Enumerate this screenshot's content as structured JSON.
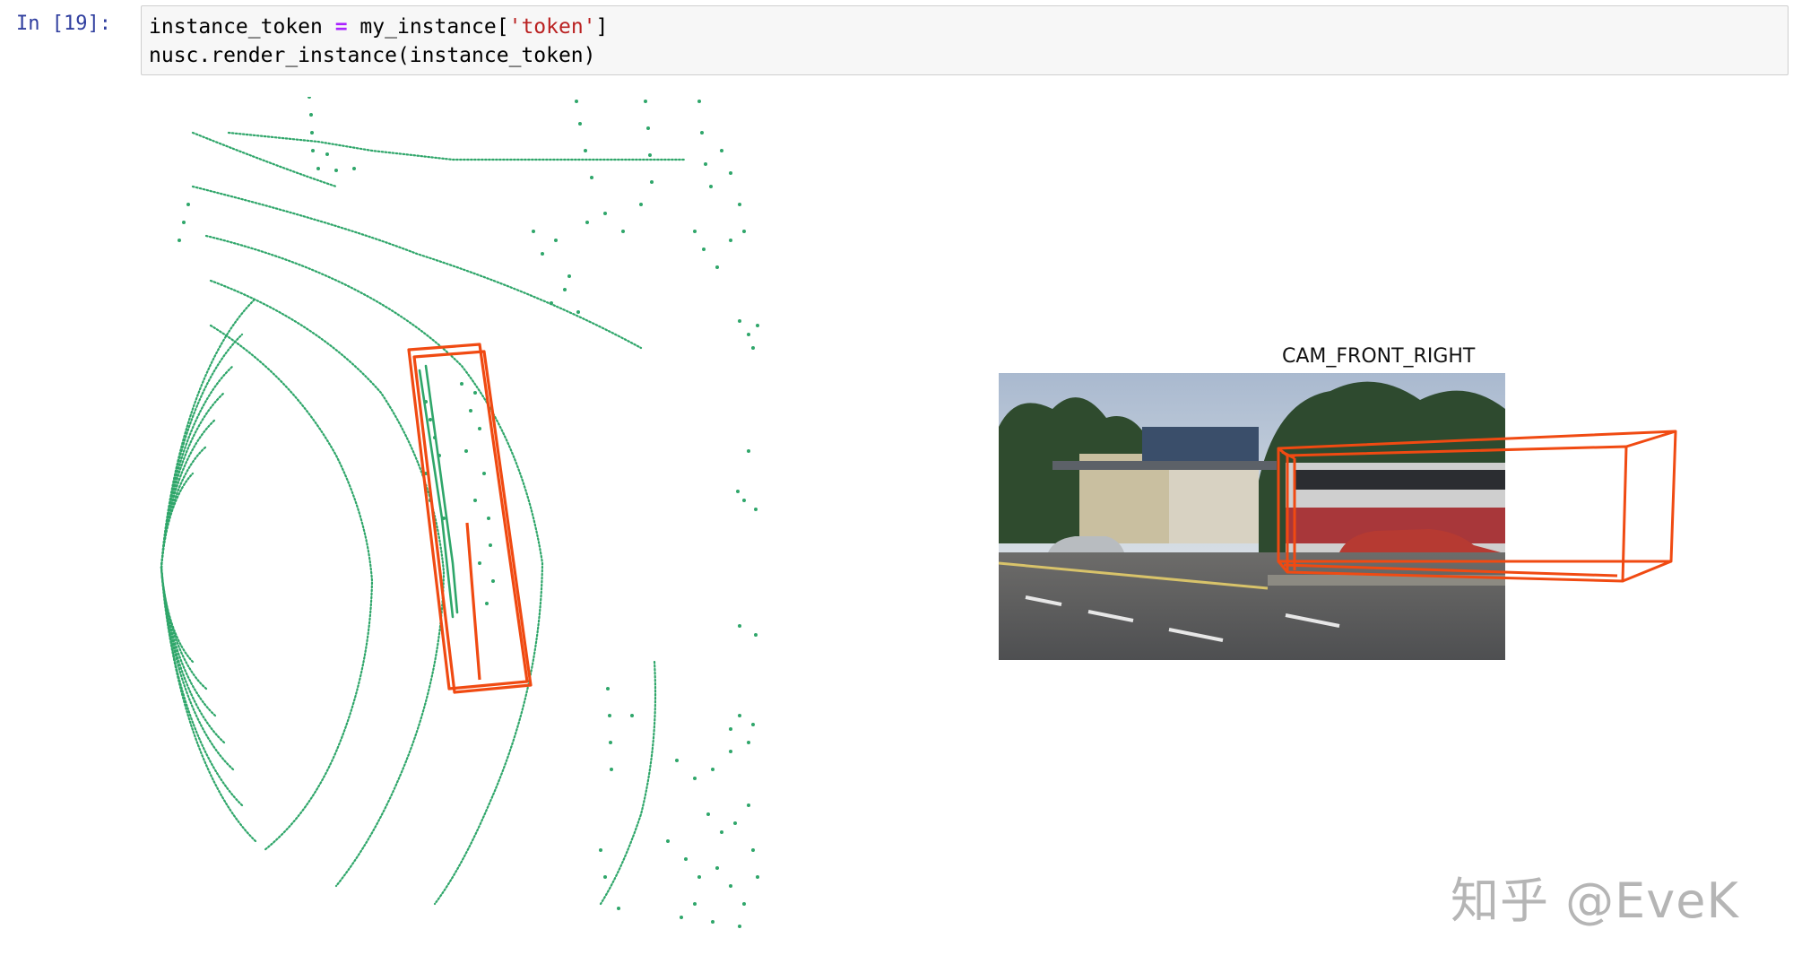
{
  "cell": {
    "prompt": "In [19]:",
    "code": {
      "line1": {
        "var": "instance_token ",
        "op": "=",
        "rest1": " my_instance[",
        "str": "'token'",
        "rest2": "]"
      },
      "line2": "nusc.render_instance(instance_token)"
    }
  },
  "output": {
    "camera_title": "CAM_FRONT_RIGHT",
    "colors": {
      "lidar_points": "#2fa66a",
      "box": "#f04a12",
      "code_prompt": "#303f9f",
      "keyword_op": "#aa22ff",
      "string": "#ba2121"
    }
  },
  "watermark": "知乎 @EveK"
}
